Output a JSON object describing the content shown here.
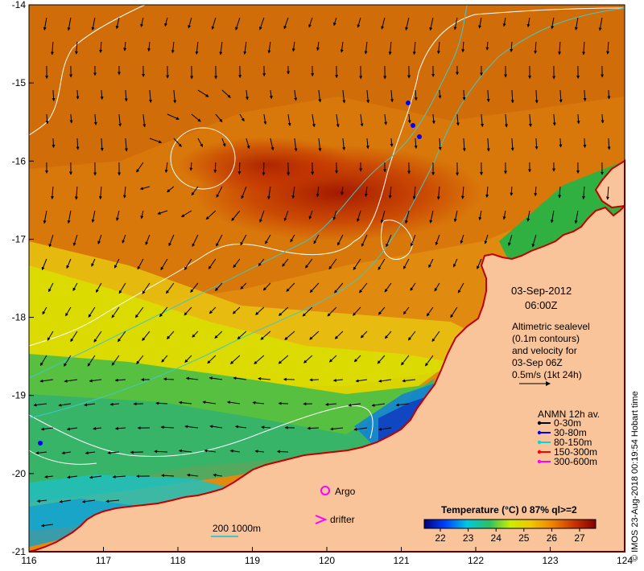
{
  "map": {
    "lon_ticks": [
      "116",
      "117",
      "118",
      "119",
      "120",
      "121",
      "122",
      "123",
      "124"
    ],
    "lat_ticks": [
      "-14",
      "-15",
      "-16",
      "-17",
      "-18",
      "-19",
      "-20",
      "-21"
    ],
    "date_line1": "03-Sep-2012",
    "date_line2": "06:00Z",
    "altimetry_lines": [
      "Altimetric sealevel",
      "(0.1m contours)",
      "and velocity for",
      "03-Sep 06Z",
      "0.5m/s (1kt 24h)"
    ],
    "anmn_title": "ANMN 12h av.",
    "anmn_items": [
      {
        "label": "0-30m",
        "color": "#000000"
      },
      {
        "label": "30-80m",
        "color": "#0000ff"
      },
      {
        "label": "80-150m",
        "color": "#00d8d8"
      },
      {
        "label": "150-300m",
        "color": "#ff0000"
      },
      {
        "label": "300-600m",
        "color": "#ff00ff"
      }
    ],
    "argo_label": "Argo",
    "drifter_label": "drifter",
    "isobath_label": "200  1000m",
    "colorbar_title": "Temperature (°C) 0 87% ql>=2",
    "colorbar_ticks": [
      "22",
      "23",
      "24",
      "25",
      "26",
      "27"
    ],
    "credit": "© IMOS 23-Aug-2018 00:19:54 Hobart time",
    "colors": {
      "land": "#f9c49a",
      "coast": "#c00000",
      "contour": "#ffffff",
      "isobath": "#40c8c8",
      "argo": "#ff00ff"
    }
  }
}
